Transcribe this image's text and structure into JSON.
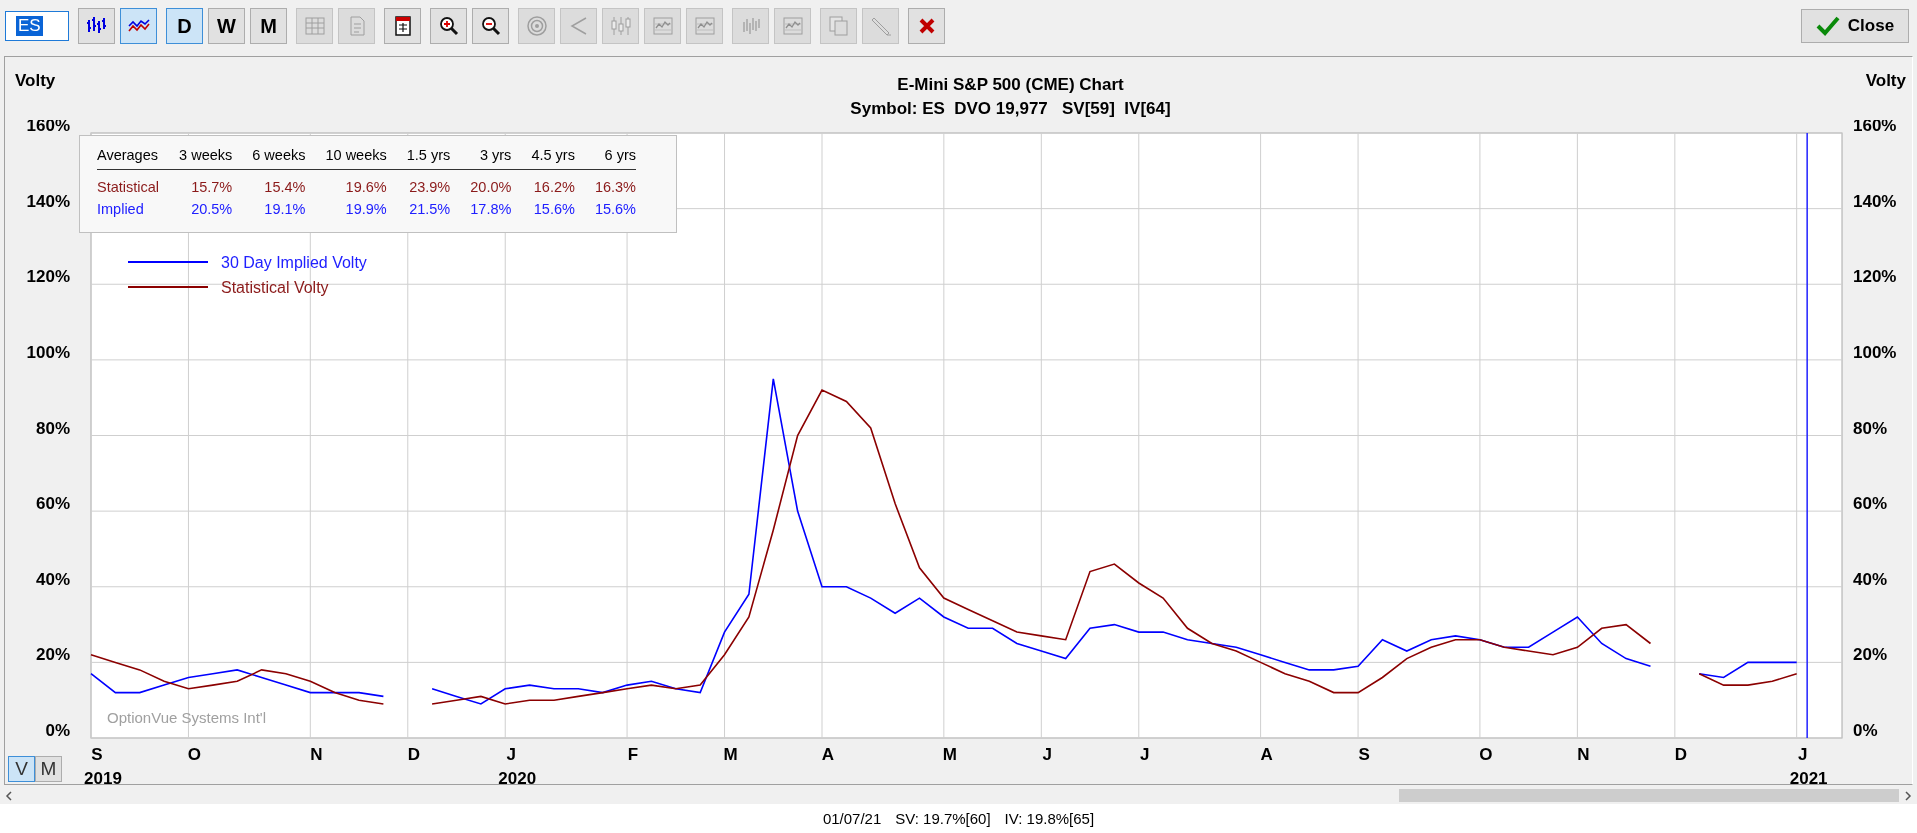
{
  "toolbar": {
    "groups": [
      [
        {
          "kind": "field",
          "value": "ES"
        }
      ],
      [
        {
          "kind": "icon",
          "selected": false,
          "disabled": false
        },
        {
          "kind": "icon",
          "selected": true,
          "disabled": false
        }
      ],
      [
        {
          "kind": "text",
          "label": "D",
          "selected": true
        },
        {
          "kind": "text",
          "label": "W",
          "selected": false
        },
        {
          "kind": "text",
          "label": "M",
          "selected": false
        }
      ],
      [
        {
          "kind": "icon",
          "disabled": true
        },
        {
          "kind": "icon",
          "disabled": true
        }
      ],
      [
        {
          "kind": "icon",
          "disabled": false
        }
      ],
      [
        {
          "kind": "icon",
          "disabled": false
        },
        {
          "kind": "icon",
          "disabled": false
        }
      ],
      [
        {
          "kind": "icon",
          "disabled": true
        },
        {
          "kind": "icon",
          "disabled": true
        },
        {
          "kind": "icon",
          "disabled": true
        },
        {
          "kind": "icon",
          "disabled": true
        },
        {
          "kind": "icon",
          "disabled": true
        }
      ],
      [
        {
          "kind": "icon",
          "disabled": true
        },
        {
          "kind": "icon",
          "disabled": true
        }
      ],
      [
        {
          "kind": "icon",
          "disabled": true
        },
        {
          "kind": "icon",
          "disabled": true
        }
      ],
      [
        {
          "kind": "icon",
          "disabled": false
        }
      ]
    ],
    "close_button": "Close"
  },
  "chart_panel": {
    "left_axis_label": "Volty",
    "title": "E-Mini S&P 500 (CME) Chart",
    "subtitle": "Symbol: ES  DVO 19,977   SV[59]  IV[64]",
    "right_axis_label": "Volty",
    "averages": {
      "columns": [
        "Averages",
        "3 weeks",
        "6 weeks",
        "10 weeks",
        "1.5 yrs",
        "3 yrs",
        "4.5 yrs",
        "6 yrs"
      ],
      "rows": [
        {
          "label": "Statistical",
          "color": "#8b1a1a",
          "values": [
            "15.7%",
            "15.4%",
            "19.6%",
            "23.9%",
            "20.0%",
            "16.2%",
            "16.3%"
          ]
        },
        {
          "label": "Implied",
          "color": "#2020ff",
          "values": [
            "20.5%",
            "19.1%",
            "19.9%",
            "21.5%",
            "17.8%",
            "15.6%",
            "15.6%"
          ]
        }
      ]
    },
    "chart_data": {
      "type": "line",
      "categories": [
        "S",
        null,
        null,
        null,
        "O",
        null,
        null,
        null,
        null,
        "N",
        null,
        null,
        null,
        "D",
        null,
        null,
        null,
        "J",
        null,
        null,
        null,
        null,
        "F",
        null,
        null,
        null,
        "M",
        null,
        null,
        null,
        "A",
        null,
        null,
        null,
        null,
        "M",
        null,
        null,
        null,
        "J",
        null,
        null,
        null,
        "J",
        null,
        null,
        null,
        null,
        "A",
        null,
        null,
        null,
        "S",
        null,
        null,
        null,
        null,
        "O",
        null,
        null,
        null,
        "N",
        null,
        null,
        null,
        "D",
        null,
        null,
        null,
        null,
        "J"
      ],
      "series": [
        {
          "name": "30 Day Implied Volty",
          "color": "#0000ff",
          "values": [
            17,
            12,
            12,
            14,
            16,
            17,
            18,
            16,
            14,
            12,
            12,
            12,
            11,
            null,
            13,
            11,
            9,
            13,
            14,
            13,
            13,
            12,
            14,
            15,
            13,
            12,
            28,
            38,
            95,
            60,
            40,
            40,
            37,
            33,
            37,
            32,
            29,
            29,
            25,
            23,
            21,
            29,
            30,
            28,
            28,
            26,
            25,
            24,
            22,
            20,
            18,
            18,
            19,
            26,
            23,
            26,
            27,
            26,
            24,
            24,
            28,
            32,
            25,
            21,
            19,
            null,
            17,
            16,
            20,
            20,
            20
          ]
        },
        {
          "name": "Statistical Volty",
          "color": "#8b0000",
          "values": [
            22,
            20,
            18,
            15,
            13,
            14,
            15,
            18,
            17,
            15,
            12,
            10,
            9,
            null,
            9,
            10,
            11,
            9,
            10,
            10,
            11,
            12,
            13,
            14,
            13,
            14,
            22,
            32,
            55,
            80,
            92,
            89,
            82,
            62,
            45,
            37,
            34,
            31,
            28,
            27,
            26,
            44,
            46,
            41,
            37,
            29,
            25,
            23,
            20,
            17,
            15,
            12,
            12,
            16,
            21,
            24,
            26,
            26,
            24,
            23,
            22,
            24,
            29,
            30,
            25,
            null,
            17,
            14,
            14,
            15,
            17
          ]
        }
      ],
      "ylim": [
        0,
        160
      ],
      "y2lim": [
        0,
        160
      ],
      "yticks": [
        {
          "value": 0,
          "label": "0%"
        },
        {
          "value": 20,
          "label": "20%"
        },
        {
          "value": 40,
          "label": "40%"
        },
        {
          "value": 60,
          "label": "60%"
        },
        {
          "value": 80,
          "label": "80%"
        },
        {
          "value": 100,
          "label": "100%"
        },
        {
          "value": 120,
          "label": "120%"
        },
        {
          "value": 140,
          "label": "140%"
        },
        {
          "value": 160,
          "label": "160%"
        }
      ],
      "y2ticks": [
        {
          "value": 0,
          "label": "0%"
        },
        {
          "value": 20,
          "label": "20%"
        },
        {
          "value": 40,
          "label": "40%"
        },
        {
          "value": 60,
          "label": "60%"
        },
        {
          "value": 80,
          "label": "80%"
        },
        {
          "value": 100,
          "label": "100%"
        },
        {
          "value": 120,
          "label": "120%"
        },
        {
          "value": 140,
          "label": "140%"
        },
        {
          "value": 160,
          "label": "160%"
        }
      ],
      "annotations": [
        "OptionVue Systems Int'l"
      ],
      "grid": true,
      "legend": true
    },
    "year_labels": [
      "2019",
      "2020",
      "2021"
    ],
    "view_toggle": [
      {
        "label": "V",
        "selected": true
      },
      {
        "label": "M",
        "selected": false
      }
    ]
  },
  "status_bar": [
    "01/07/21",
    "SV: 19.7%[60]",
    "IV: 19.8%[65]"
  ]
}
